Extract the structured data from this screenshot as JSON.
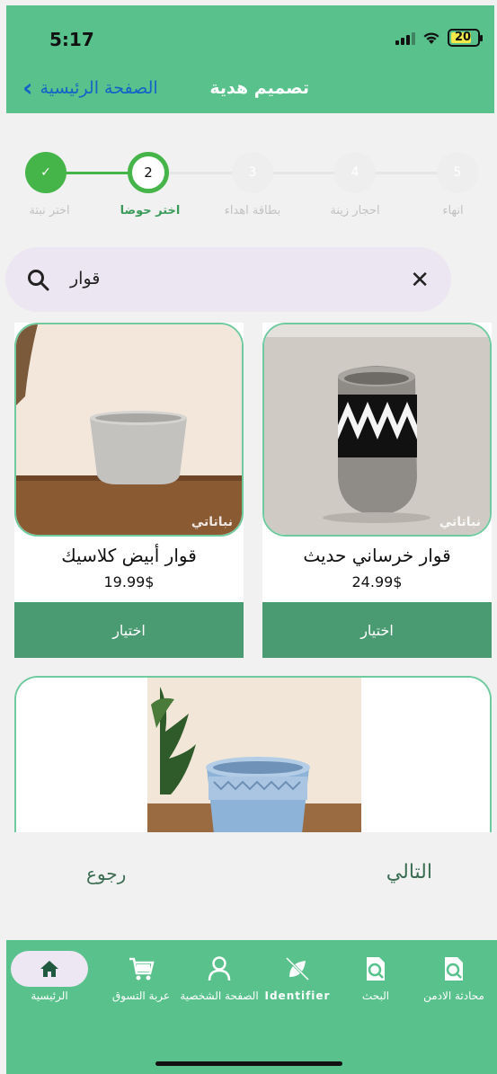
{
  "status": {
    "time": "5:17",
    "battery": "20"
  },
  "header": {
    "title": "تصميم هدية",
    "back_label": "الصفحة الرئيسية"
  },
  "steps": [
    {
      "number": "5",
      "label": "انهاء",
      "state": "pending"
    },
    {
      "number": "4",
      "label": "احجار زينة",
      "state": "pending"
    },
    {
      "number": "3",
      "label": "بطاقة اهداء",
      "state": "pending"
    },
    {
      "number": "2",
      "label": "اختر حوضا",
      "state": "active"
    },
    {
      "number": "✓",
      "label": "اختر نبتة",
      "state": "done"
    }
  ],
  "search": {
    "value": "قوار"
  },
  "products": [
    {
      "name": "قوار خرساني حديث",
      "price": "24.99$",
      "button": "اختيار",
      "watermark": "نباتاتي"
    },
    {
      "name": "قوار أبيض كلاسيك",
      "price": "19.99$",
      "button": "اختيار",
      "watermark": "نباتاتي"
    }
  ],
  "actions": {
    "next": "التالي",
    "back": "رجوع"
  },
  "bottom_nav": [
    {
      "label": "محادثة الادمن",
      "icon": "admin-chat-icon"
    },
    {
      "label": "البحث",
      "icon": "search-doc-icon"
    },
    {
      "label": "Identifier",
      "icon": "identifier-icon"
    },
    {
      "label": "الصفحة الشخصية",
      "icon": "profile-icon"
    },
    {
      "label": "عربة التسوق",
      "icon": "cart-icon"
    },
    {
      "label": "الرئيسية",
      "icon": "home-icon"
    }
  ],
  "colors": {
    "primary": "#58c18c",
    "button": "#4a9a72",
    "link": "#1463c7",
    "done_step": "#45b449"
  }
}
